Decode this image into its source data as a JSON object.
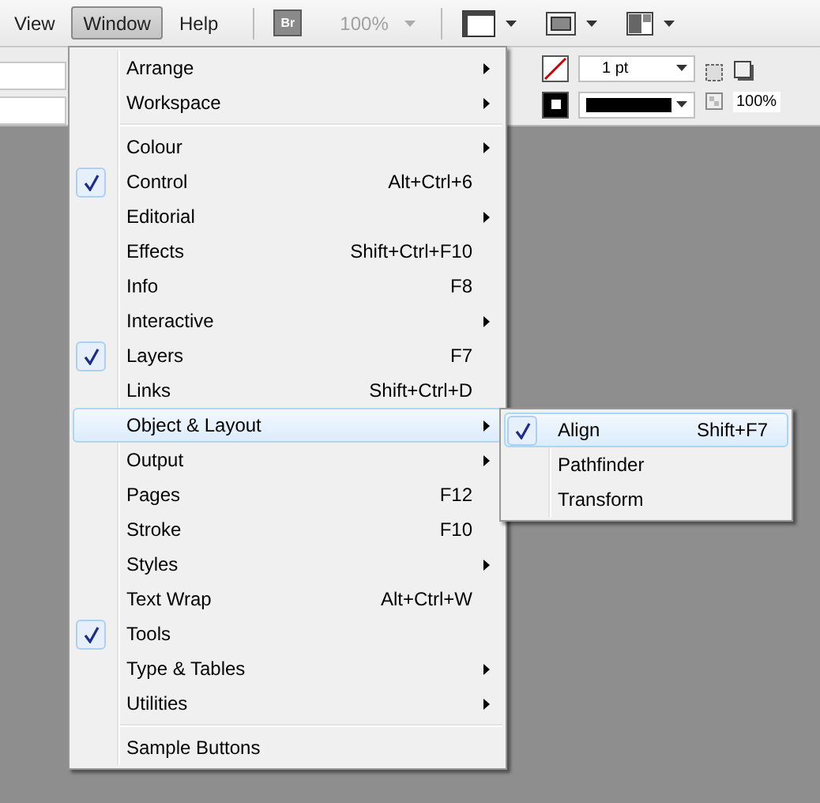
{
  "menubar": [
    {
      "label": "View",
      "selected": false
    },
    {
      "label": "Window",
      "selected": true
    },
    {
      "label": "Help",
      "selected": false
    }
  ],
  "toolbar": {
    "bridge": "Br",
    "zoom": "100%"
  },
  "control_panel": {
    "stroke_weight": "1 pt",
    "opacity": "100%"
  },
  "window_menu": {
    "groups": [
      [
        {
          "label": "Arrange",
          "submenu": true,
          "checked": false,
          "selected": false
        },
        {
          "label": "Workspace",
          "submenu": true,
          "checked": false,
          "selected": false
        }
      ],
      [
        {
          "label": "Colour",
          "submenu": true,
          "checked": false,
          "selected": false
        },
        {
          "label": "Control",
          "shortcut": "Alt+Ctrl+6",
          "submenu": false,
          "checked": true,
          "selected": false
        },
        {
          "label": "Editorial",
          "submenu": true,
          "checked": false,
          "selected": false
        },
        {
          "label": "Effects",
          "shortcut": "Shift+Ctrl+F10",
          "submenu": false,
          "checked": false,
          "selected": false
        },
        {
          "label": "Info",
          "shortcut": "F8",
          "submenu": false,
          "checked": false,
          "selected": false
        },
        {
          "label": "Interactive",
          "submenu": true,
          "checked": false,
          "selected": false
        },
        {
          "label": "Layers",
          "shortcut": "F7",
          "submenu": false,
          "checked": true,
          "selected": false
        },
        {
          "label": "Links",
          "shortcut": "Shift+Ctrl+D",
          "submenu": false,
          "checked": false,
          "selected": false
        },
        {
          "label": "Object & Layout",
          "submenu": true,
          "checked": false,
          "selected": true
        },
        {
          "label": "Output",
          "submenu": true,
          "checked": false,
          "selected": false
        },
        {
          "label": "Pages",
          "shortcut": "F12",
          "submenu": false,
          "checked": false,
          "selected": false
        },
        {
          "label": "Stroke",
          "shortcut": "F10",
          "submenu": false,
          "checked": false,
          "selected": false
        },
        {
          "label": "Styles",
          "submenu": true,
          "checked": false,
          "selected": false
        },
        {
          "label": "Text Wrap",
          "shortcut": "Alt+Ctrl+W",
          "submenu": false,
          "checked": false,
          "selected": false
        },
        {
          "label": "Tools",
          "submenu": false,
          "checked": true,
          "selected": false
        },
        {
          "label": "Type & Tables",
          "submenu": true,
          "checked": false,
          "selected": false
        },
        {
          "label": "Utilities",
          "submenu": true,
          "checked": false,
          "selected": false
        }
      ],
      [
        {
          "label": "Sample Buttons",
          "submenu": false,
          "checked": false,
          "selected": false
        }
      ]
    ]
  },
  "submenu": {
    "items": [
      {
        "label": "Align",
        "shortcut": "Shift+F7",
        "checked": true,
        "selected": true
      },
      {
        "label": "Pathfinder",
        "checked": false,
        "selected": false
      },
      {
        "label": "Transform",
        "checked": false,
        "selected": false
      }
    ]
  }
}
